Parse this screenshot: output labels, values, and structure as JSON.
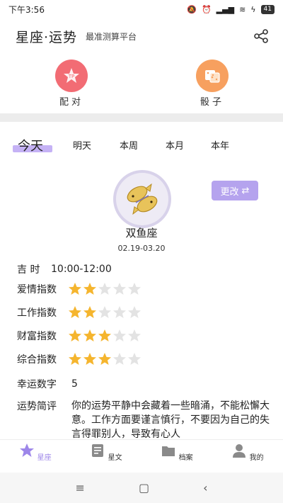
{
  "status_bar": {
    "time": "下午3:56",
    "battery": "41"
  },
  "header": {
    "title": "星座·运势",
    "subtitle": "最准测算平台"
  },
  "quick_actions": [
    {
      "label": "配对",
      "color": "#f26c74"
    },
    {
      "label": "骰子",
      "color": "#f7a05f"
    }
  ],
  "tabs": [
    "今天",
    "明天",
    "本周",
    "本月",
    "本年"
  ],
  "active_tab": "今天",
  "sign": {
    "name": "双鱼座",
    "dates": "02.19-03.20",
    "change_label": "更改"
  },
  "lucky_time": {
    "label": "吉 时",
    "value": "10:00-12:00"
  },
  "ratings": [
    {
      "label": "爱情指数",
      "stars": 2,
      "max": 5
    },
    {
      "label": "工作指数",
      "stars": 2,
      "max": 5
    },
    {
      "label": "财富指数",
      "stars": 3,
      "max": 5
    },
    {
      "label": "综合指数",
      "stars": 3,
      "max": 5
    }
  ],
  "lucky_number": {
    "label": "幸运数字",
    "value": "5"
  },
  "summary": {
    "label": "运势简评",
    "text": "你的运势平静中会藏着一些暗涌，不能松懈大意。工作方面要谨言慎行，不要因为自己的失言得罪别人，导致有心人"
  },
  "bottom_nav": [
    {
      "label": "星座",
      "active": true
    },
    {
      "label": "星文",
      "active": false
    },
    {
      "label": "档案",
      "active": false
    },
    {
      "label": "我的",
      "active": false
    }
  ],
  "colors": {
    "accent": "#b5a3ee",
    "star_on": "#f5b52e",
    "star_off": "#e3e3e3"
  }
}
